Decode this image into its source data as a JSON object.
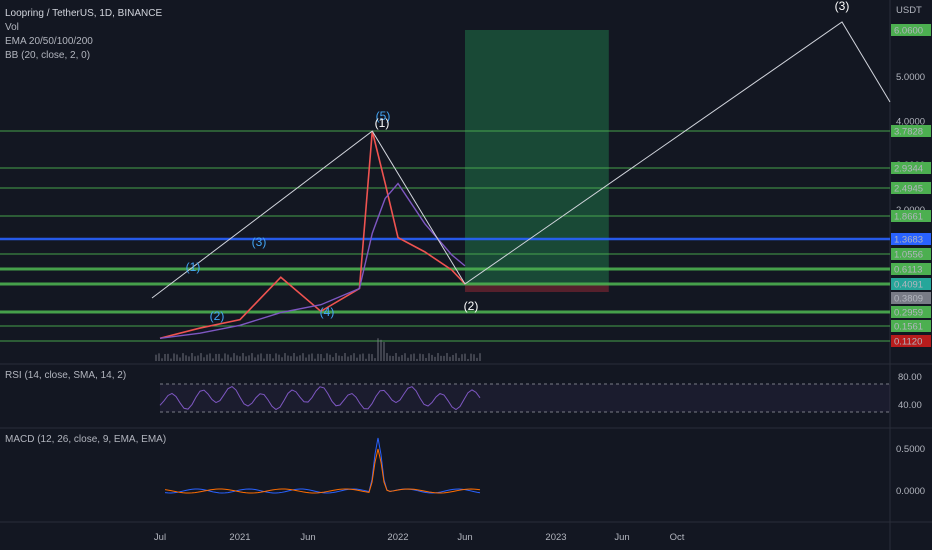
{
  "header": {
    "symbol_line": "Loopring / TetherUS, 1D, BINANCE",
    "vol_label": "Vol",
    "ema_label": "EMA 20/50/100/200",
    "bb_label": "BB (20, close, 2, 0)",
    "currency": "USDT"
  },
  "rsi": {
    "label": "RSI (14, close, SMA, 14, 2)",
    "levels": [
      "80.00",
      "40.00"
    ]
  },
  "macd": {
    "label": "MACD (12, 26, close, 9, EMA, EMA)",
    "levels": [
      "0.5000",
      "0.0000"
    ]
  },
  "price_axis": {
    "plain_ticks": [
      "5.0000",
      "4.0000",
      "3.0000",
      "2.0000"
    ],
    "tags": [
      {
        "label": "6.0600",
        "price": 6.06,
        "color": "#4caf50"
      },
      {
        "label": "3.7828",
        "price": 3.7828,
        "color": "#4caf50"
      },
      {
        "label": "2.9344",
        "price": 2.9344,
        "color": "#4caf50"
      },
      {
        "label": "2.4945",
        "price": 2.4945,
        "color": "#4caf50"
      },
      {
        "label": "1.8661",
        "price": 1.8661,
        "color": "#4caf50"
      },
      {
        "label": "1.3683",
        "price": 1.3683,
        "color": "#2962ff"
      },
      {
        "label": "1.0556",
        "price": 1.0556,
        "color": "#4caf50"
      },
      {
        "label": "0.6113",
        "price": 0.6113,
        "color": "#4caf50"
      },
      {
        "label": "0.4091",
        "price": 0.4091,
        "color": "#26a69a"
      },
      {
        "label": "0.3809",
        "price": 0.3809,
        "color": "#787b86"
      },
      {
        "label": "0.2959",
        "price": 0.2959,
        "color": "#4caf50"
      },
      {
        "label": "0.1561",
        "price": 0.1561,
        "color": "#4caf50"
      },
      {
        "label": "0.1120",
        "price": 0.112,
        "color": "#b71c1c"
      }
    ]
  },
  "time_axis": {
    "ticks": [
      "Jul",
      "2021",
      "Jun",
      "2022",
      "Jun",
      "2023",
      "Jun",
      "Oct"
    ]
  },
  "chart_data": {
    "type": "line",
    "title": "Loopring / TetherUS, 1D, BINANCE",
    "x": [
      "2020-07",
      "2020-10",
      "2021-01",
      "2021-04",
      "2021-07",
      "2021-10",
      "2021-11",
      "2021-12",
      "2022-01",
      "2022-03",
      "2022-05",
      "2022-06"
    ],
    "series": [
      {
        "values": [
          0.12,
          0.15,
          0.22,
          0.5,
          0.3,
          0.4,
          3.78,
          2.6,
          1.4,
          1.1,
          0.6,
          0.41
        ]
      }
    ],
    "horizontal_levels": [
      3.7828,
      2.9344,
      2.4945,
      1.8661,
      1.3683,
      1.0556,
      0.6113,
      0.4091,
      0.2959,
      0.1561,
      0.112
    ],
    "target_box": {
      "from": "2022-06",
      "to": "2023-05",
      "low": 0.4091,
      "high": 6.06
    },
    "wave_labels": [
      "(1)",
      "(2)",
      "(3)",
      "(4)",
      "(5)",
      "(1)",
      "(2)",
      "(3)"
    ],
    "legend": "top-left",
    "grid": false
  }
}
